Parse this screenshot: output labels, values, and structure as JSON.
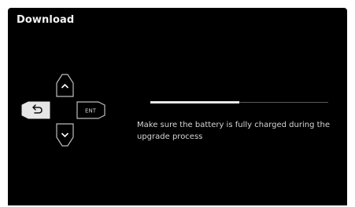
{
  "screen": {
    "title": "Download",
    "message": "Make sure the battery is fully charged during the upgrade process",
    "progress": 0.5
  },
  "dpad": {
    "enter_label": "ENT",
    "up_icon": "chevron-up-icon",
    "down_icon": "chevron-down-icon",
    "back_icon": "back-arrow-icon"
  },
  "colors": {
    "background": "#000000",
    "text": "#d6d6d6",
    "progress_fill": "#e8e8e8",
    "progress_track": "#5a5a5a",
    "back_button": "#e6e6e6",
    "outline": "#bdbdbd"
  }
}
